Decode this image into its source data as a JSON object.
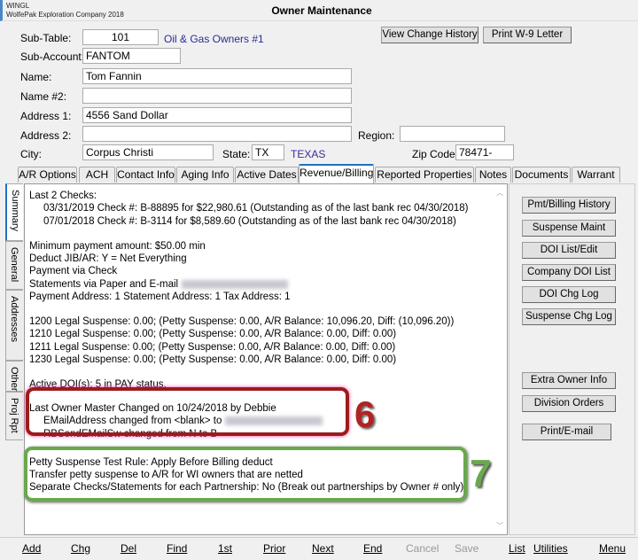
{
  "window": {
    "app": "WINGL",
    "company": "WolfePak Exploration Company 2018",
    "title": "Owner Maintenance"
  },
  "header_buttons": {
    "view_change_history": "View Change History",
    "print_w9": "Print W-9 Letter"
  },
  "form": {
    "sub_table_label": "Sub-Table:",
    "sub_table_value": "101",
    "sub_table_desc": "Oil & Gas Owners #1",
    "sub_account_label": "Sub-Account:",
    "sub_account_value": "FANTOM",
    "name_label": "Name:",
    "name_value": "Tom Fannin",
    "name2_label": "Name #2:",
    "name2_value": "",
    "address1_label": "Address 1:",
    "address1_value": "4556 Sand Dollar",
    "address2_label": "Address 2:",
    "address2_value": "",
    "region_label": "Region:",
    "region_value": "",
    "city_label": "City:",
    "city_value": "Corpus Christi",
    "state_label": "State:",
    "state_value": "TX",
    "state_name": "TEXAS",
    "zip_label": "Zip Code:",
    "zip_value": "78471-"
  },
  "tabs": [
    "A/R Options",
    "ACH",
    "Contact Info",
    "Aging Info",
    "Active Dates",
    "Revenue/Billing",
    "Reported Properties",
    "Notes",
    "Documents",
    "Warrant"
  ],
  "active_tab": "Revenue/Billing",
  "side_tabs": [
    "Summary",
    "General",
    "Addresses",
    "Other",
    "Proj Rpt"
  ],
  "summary": {
    "l1": "Last 2 Checks:",
    "l2": "03/31/2019 Check #: B-88895 for $22,980.61  (Outstanding as of the last bank rec 04/30/2018)",
    "l3": "07/01/2018 Check #: B-3114 for $8,589.60  (Outstanding as of the last bank rec 04/30/2018)",
    "l4": "Minimum payment amount: $50.00  min",
    "l5": "Deduct JIB/AR: Y = Net Everything",
    "l6": "Payment via Check",
    "l7": "Statements via Paper and E-mail",
    "l8": "Payment Address: 1 Statement Address: 1 Tax Address: 1",
    "l9": "1200 Legal Suspense: 0.00;  (Petty Suspense: 0.00, A/R Balance: 10,096.20, Diff: (10,096.20))",
    "l10": "1210 Legal Suspense: 0.00;  (Petty Suspense: 0.00, A/R Balance: 0.00, Diff: 0.00)",
    "l11": "1211 Legal Suspense: 0.00;  (Petty Suspense: 0.00, A/R Balance: 0.00, Diff: 0.00)",
    "l12": "1230 Legal Suspense: 0.00;  (Petty Suspense: 0.00, A/R Balance: 0.00, Diff: 0.00)",
    "l13": "Active DOI(s): 5 in PAY status.",
    "l14": "Last Owner Master Changed on 10/24/2018 by Debbie",
    "l15": "EMailAddress changed from <blank> to",
    "l16": "RBSendEMailSw changed from N to B",
    "l17": "Petty Suspense Test Rule: Apply Before Billing deduct",
    "l18": "Transfer petty suspense to A/R for WI owners that are netted",
    "l19": "Separate Checks/Statements for each Partnership: No (Break out partnerships by Owner # only)"
  },
  "annotations": {
    "a6": "6",
    "a7": "7",
    "color6": "#b22222",
    "color7": "#6aa84f"
  },
  "right_buttons": [
    "Pmt/Billing History",
    "Suspense Maint",
    "DOI List/Edit",
    "Company DOI List",
    "DOI Chg Log",
    "Suspense Chg Log",
    "Extra Owner Info",
    "Division Orders",
    "Print/E-mail"
  ],
  "toolbar": [
    "Add",
    "Chg",
    "Del",
    "Find",
    "1st",
    "Prior",
    "Next",
    "End",
    "Cancel",
    "Save",
    "List",
    "Utilities",
    "Menu"
  ],
  "toolbar_disabled": [
    "Cancel",
    "Save"
  ]
}
